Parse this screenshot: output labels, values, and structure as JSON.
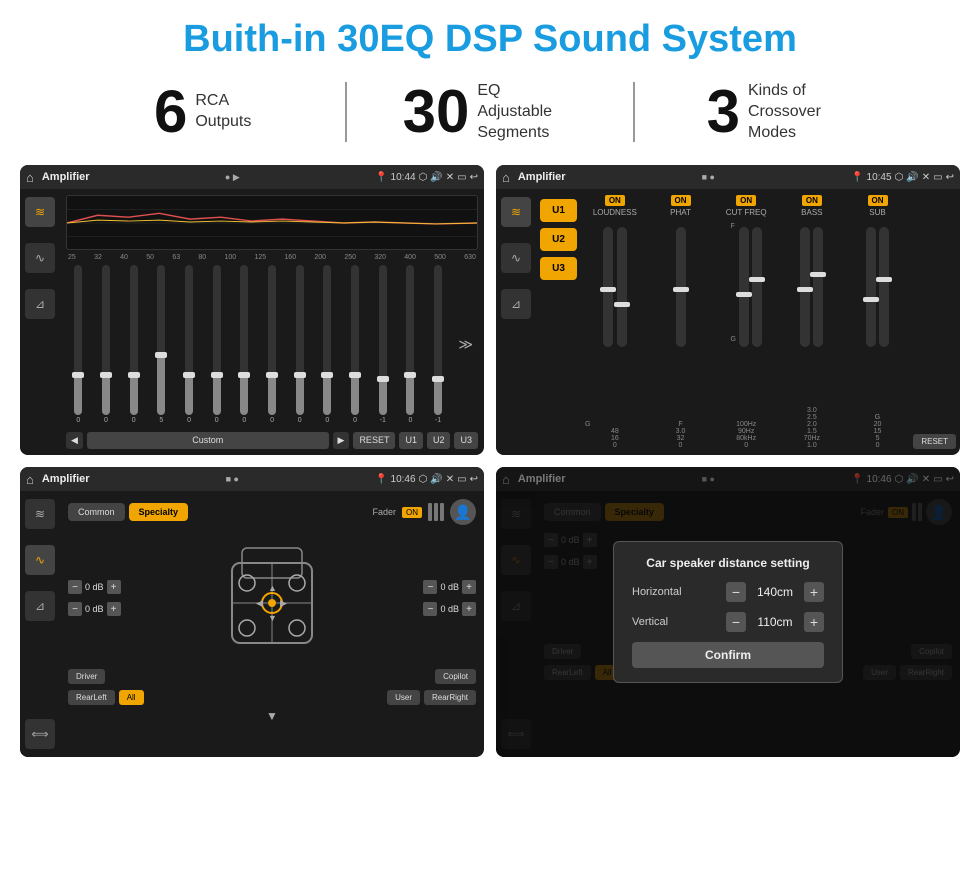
{
  "page": {
    "title": "Buith-in 30EQ DSP Sound System",
    "stats": [
      {
        "number": "6",
        "label": "RCA\nOutputs"
      },
      {
        "number": "30",
        "label": "EQ Adjustable\nSegments"
      },
      {
        "number": "3",
        "label": "Kinds of\nCrossover Modes"
      }
    ]
  },
  "screen1": {
    "status": "Amplifier",
    "time": "10:44",
    "mode": "Custom",
    "freq_labels": [
      "25",
      "32",
      "40",
      "50",
      "63",
      "80",
      "100",
      "125",
      "160",
      "200",
      "250",
      "320",
      "400",
      "500",
      "630"
    ],
    "values": [
      "0",
      "0",
      "0",
      "5",
      "0",
      "0",
      "0",
      "0",
      "0",
      "0",
      "0",
      "-1",
      "0",
      "-1"
    ],
    "buttons": [
      "Custom",
      "RESET",
      "U1",
      "U2",
      "U3"
    ]
  },
  "screen2": {
    "status": "Amplifier",
    "time": "10:45",
    "u_buttons": [
      "U1",
      "U2",
      "U3"
    ],
    "controls": [
      {
        "label": "LOUDNESS",
        "on": true
      },
      {
        "label": "PHAT",
        "on": true
      },
      {
        "label": "CUT FREQ",
        "on": true
      },
      {
        "label": "BASS",
        "on": true
      },
      {
        "label": "SUB",
        "on": true
      }
    ],
    "reset": "RESET"
  },
  "screen3": {
    "status": "Amplifier",
    "time": "10:46",
    "tabs": [
      "Common",
      "Specialty"
    ],
    "active_tab": "Specialty",
    "fader_label": "Fader",
    "fader_on": "ON",
    "speaker_positions": [
      "Driver",
      "RearLeft",
      "Copilot",
      "RearRight"
    ],
    "all_btn": "All",
    "user_btn": "User",
    "db_values": [
      "0 dB",
      "0 dB",
      "0 dB",
      "0 dB"
    ]
  },
  "screen4": {
    "status": "Amplifier",
    "time": "10:46",
    "tabs": [
      "Common",
      "Specialty"
    ],
    "dialog": {
      "title": "Car speaker distance setting",
      "rows": [
        {
          "label": "Horizontal",
          "value": "140cm"
        },
        {
          "label": "Vertical",
          "value": "110cm"
        }
      ],
      "confirm_label": "Confirm"
    },
    "speaker_positions": [
      "Driver",
      "RearLeft",
      "Copilot",
      "RearRight"
    ],
    "db_values": [
      "0 dB",
      "0 dB"
    ]
  },
  "icons": {
    "home": "⌂",
    "play": "▶",
    "back": "↩",
    "eq": "≡",
    "wave": "~",
    "sound": "♪",
    "pin": "📍",
    "camera": "⬡",
    "volume": "🔊",
    "grid": "⊞",
    "minus": "─",
    "arrow_left": "◀",
    "arrow_right": "▶",
    "arrow_up": "▲",
    "arrow_down": "▼",
    "expand": "≫",
    "person": "👤",
    "minus_sign": "−",
    "plus_sign": "+"
  }
}
